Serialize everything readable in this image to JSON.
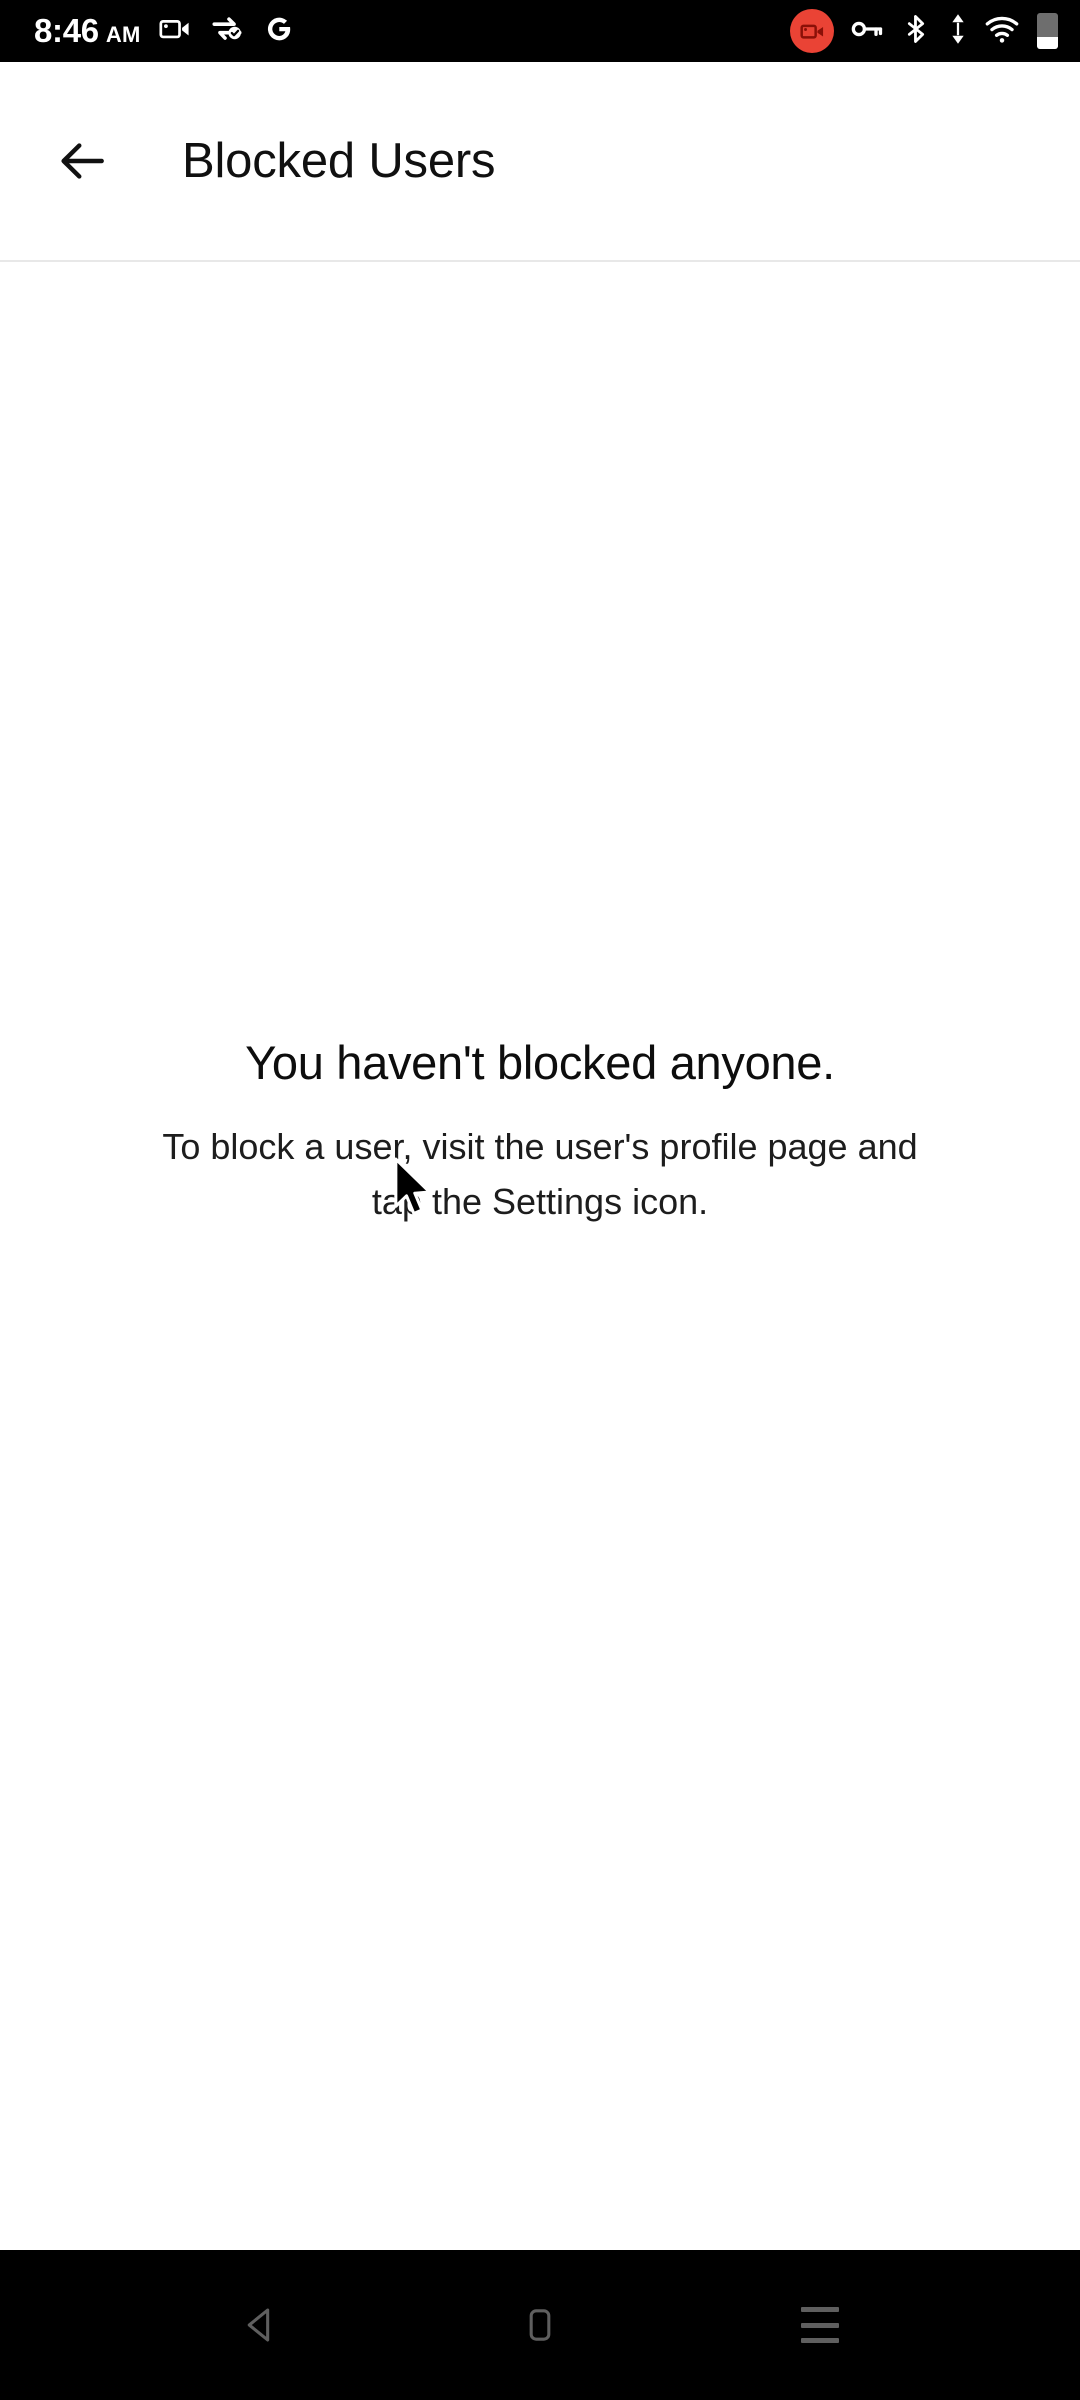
{
  "status_bar": {
    "time": "8:46",
    "meridiem": "AM",
    "left_icons": [
      {
        "name": "screen-record-icon",
        "label": "screen recording"
      },
      {
        "name": "data-sync-icon",
        "label": "sync"
      },
      {
        "name": "google-icon",
        "label": "G"
      }
    ],
    "right_icons": [
      {
        "name": "screen-record-badge-icon",
        "label": "recording",
        "color": "#ea4335"
      },
      {
        "name": "vpn-key-icon",
        "label": "vpn"
      },
      {
        "name": "bluetooth-icon",
        "label": "bluetooth"
      },
      {
        "name": "data-transfer-icon",
        "label": "data transfer"
      },
      {
        "name": "wifi-icon",
        "label": "wifi"
      },
      {
        "name": "battery-icon",
        "label": "battery",
        "level_percent": 32
      }
    ]
  },
  "app_bar": {
    "back_label": "Back",
    "title": "Blocked Users"
  },
  "content": {
    "empty_title": "You haven't blocked anyone.",
    "empty_description": "To block a user, visit the user's profile page and tap the Settings icon."
  },
  "nav_bar": {
    "back_label": "Back",
    "home_label": "Home",
    "recents_label": "Recents"
  },
  "colors": {
    "status_bar_bg": "#000000",
    "nav_bar_bg": "#000000",
    "page_bg": "#ffffff",
    "text_primary": "#0d0d0d",
    "text_secondary": "#1d1d1d",
    "accent_record": "#ea4335",
    "divider": "#e8e8e8"
  }
}
